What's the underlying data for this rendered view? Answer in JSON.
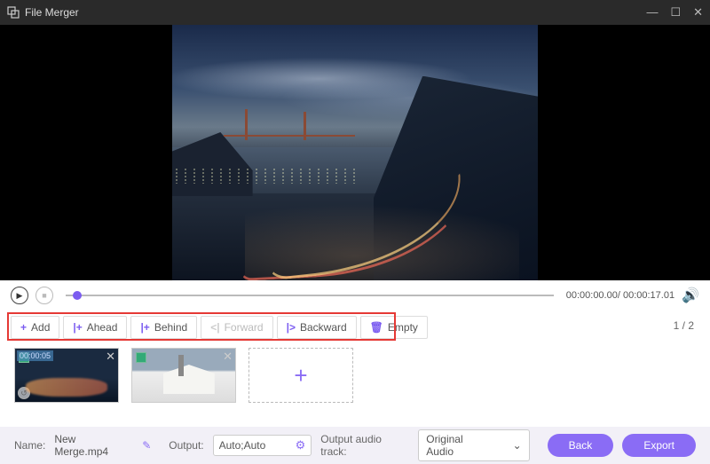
{
  "window": {
    "title": "File Merger"
  },
  "playback": {
    "time": "00:00:00.00/ 00:00:17.01"
  },
  "toolbar": {
    "add": "Add",
    "ahead": "Ahead",
    "behind": "Behind",
    "forward": "Forward",
    "backward": "Backward",
    "empty": "Empty",
    "page": "1 / 2"
  },
  "clips": [
    {
      "timestamp": "00:00:05"
    },
    {
      "timestamp": ""
    }
  ],
  "footer": {
    "name_label": "Name:",
    "name_value": "New Merge.mp4",
    "output_label": "Output:",
    "output_value": "Auto;Auto",
    "audio_label": "Output audio track:",
    "audio_value": "Original Audio",
    "back": "Back",
    "export": "Export"
  }
}
